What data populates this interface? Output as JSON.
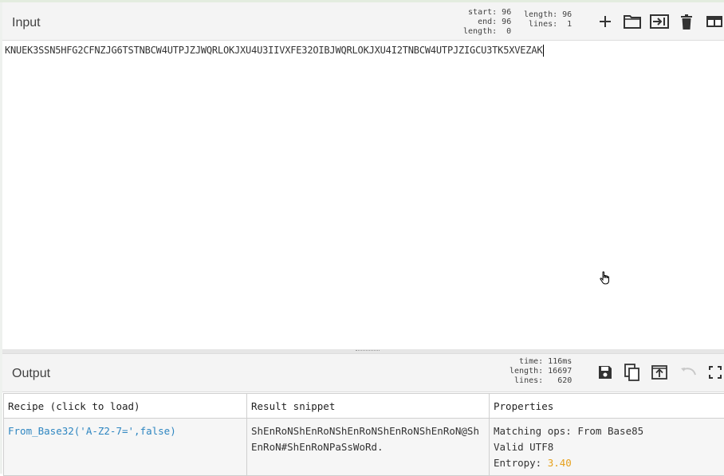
{
  "input": {
    "title": "Input",
    "stats_left": "start: 96\n  end: 96\nlength:  0",
    "stats_right": "length: 96\n lines:  1",
    "text": "KNUEK3SSN5HFG2CFNZJG6TSTNBCW4UTPJZJWQRLOKJXU4U3IIVXFE32OIBJWQRLOKJXU4I2TNBCW4UTPJZIGCU3TK5XVEZAK"
  },
  "toolbar_input": {
    "add_icon": "plus-icon",
    "open_icon": "folder-icon",
    "load_icon": "input-to-output-icon",
    "clear_icon": "trash-icon",
    "layout_icon": "layout-icon"
  },
  "output": {
    "title": "Output",
    "stats": "time: 116ms\nlength: 16697\nlines:   620"
  },
  "toolbar_output": {
    "save_icon": "save-icon",
    "copy_icon": "copy-icon",
    "replace_icon": "replace-input-icon",
    "undo_icon": "undo-icon",
    "maximise_icon": "maximise-icon"
  },
  "results_table": {
    "headers": [
      "Recipe (click to load)",
      "Result snippet",
      "Properties"
    ],
    "rows": [
      {
        "recipe": "From_Base32('A-Z2-7=',false)",
        "snippet": "ShEnRoNShEnRoNShEnRoNShEnRoNShEnRoN@ShEnRoN#ShEnRoNPaSsWoRd.",
        "props_line1": "Matching ops: From Base85",
        "props_line2": "Valid UTF8",
        "entropy_label": "Entropy: ",
        "entropy_value": "3.40"
      }
    ]
  },
  "colors": {
    "accent_link": "#2e86c1",
    "entropy": "#e6a11d"
  }
}
